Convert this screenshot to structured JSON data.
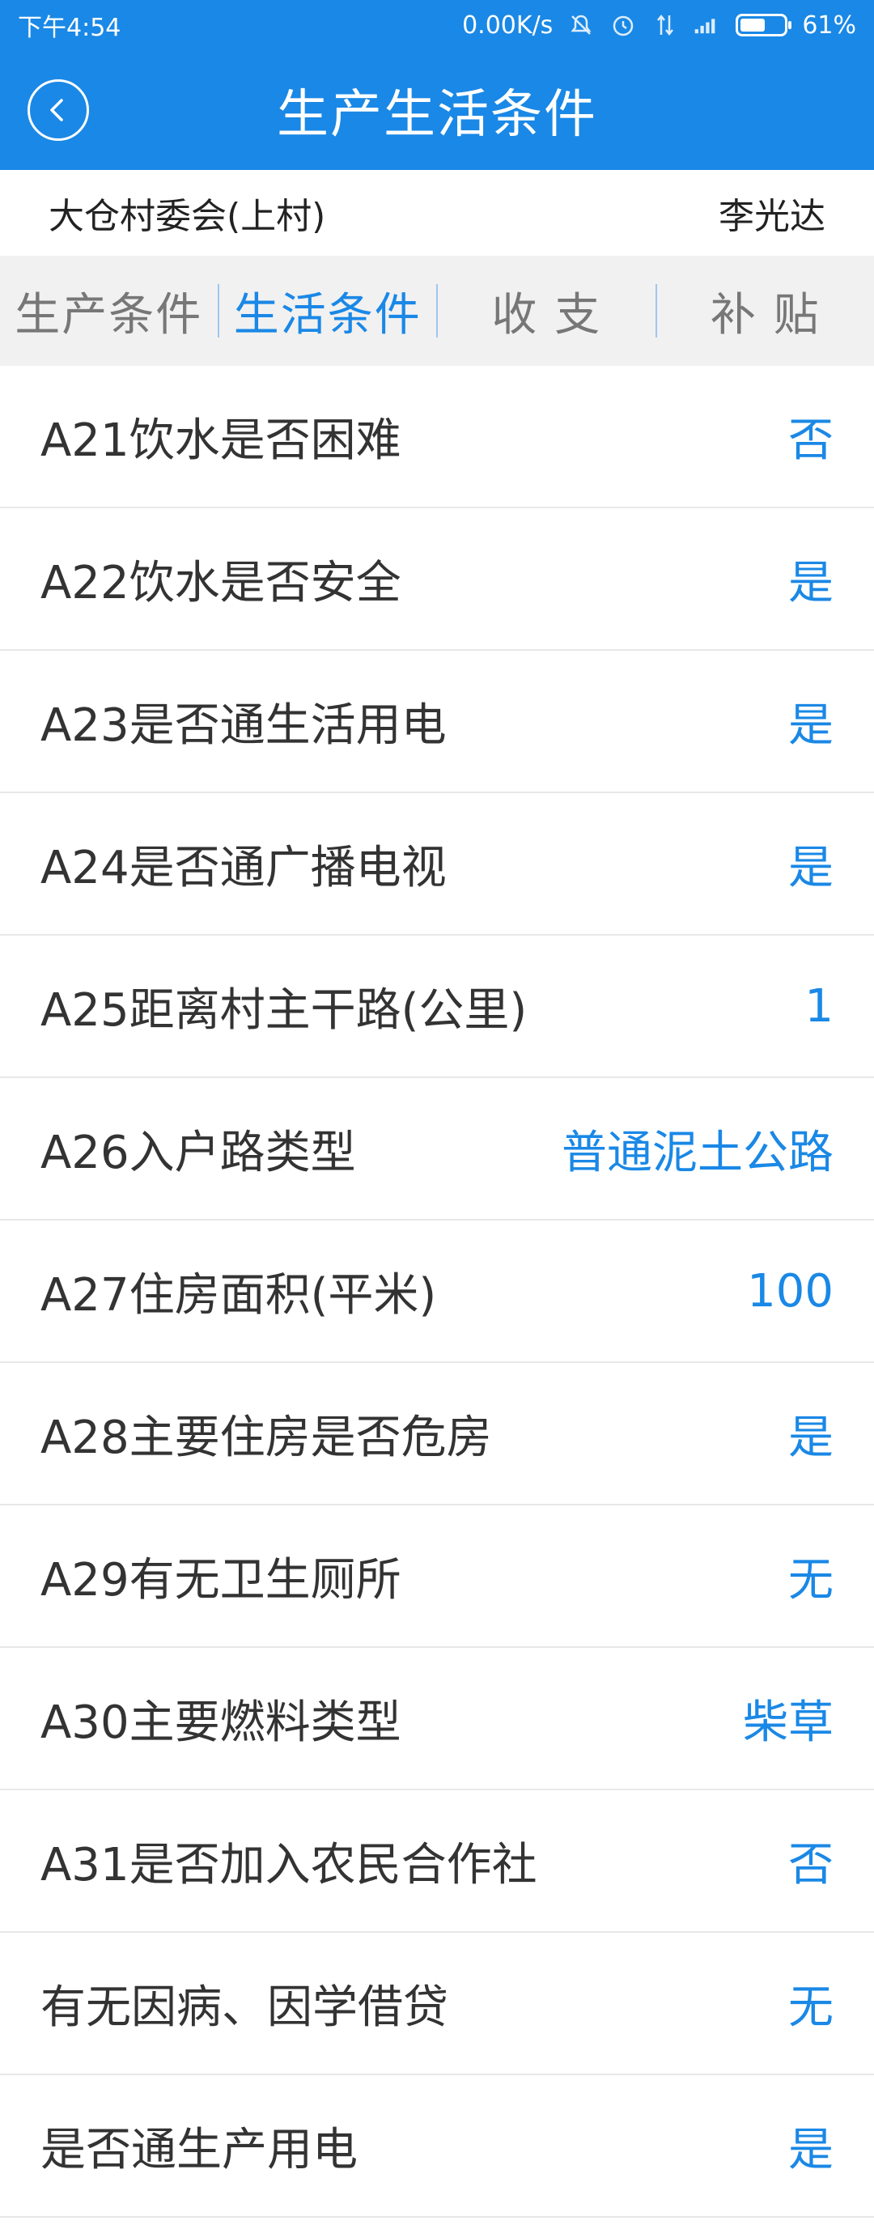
{
  "status_bar": {
    "time": "下午4:54",
    "network_speed": "0.00K/s",
    "battery_percent": "61%",
    "battery_level": 0.61,
    "icons": [
      "mute-icon",
      "alarm-icon",
      "data-arrows-icon",
      "signal-icon"
    ]
  },
  "header": {
    "back_icon": "back-icon",
    "title": "生产生活条件"
  },
  "info": {
    "organization": "大仓村委会(上村)",
    "person": "李光达"
  },
  "tabs": [
    {
      "label": "生产条件"
    },
    {
      "label": "生活条件"
    },
    {
      "label": "收 支"
    },
    {
      "label": "补 贴"
    }
  ],
  "active_tab": 1,
  "rows": [
    {
      "label": "A21饮水是否困难",
      "value": "否"
    },
    {
      "label": "A22饮水是否安全",
      "value": "是"
    },
    {
      "label": "A23是否通生活用电",
      "value": "是"
    },
    {
      "label": "A24是否通广播电视",
      "value": "是"
    },
    {
      "label": "A25距离村主干路(公里)",
      "value": "1"
    },
    {
      "label": "A26入户路类型",
      "value": "普通泥土公路"
    },
    {
      "label": "A27住房面积(平米)",
      "value": "100"
    },
    {
      "label": "A28主要住房是否危房",
      "value": "是"
    },
    {
      "label": "A29有无卫生厕所",
      "value": "无"
    },
    {
      "label": "A30主要燃料类型",
      "value": "柴草"
    },
    {
      "label": "A31是否加入农民合作社",
      "value": "否"
    },
    {
      "label": "有无因病、因学借贷",
      "value": "无"
    },
    {
      "label": "是否通生产用电",
      "value": "是"
    }
  ],
  "colors": {
    "primary": "#1a88e6",
    "tab_background": "#f1f1f1"
  }
}
